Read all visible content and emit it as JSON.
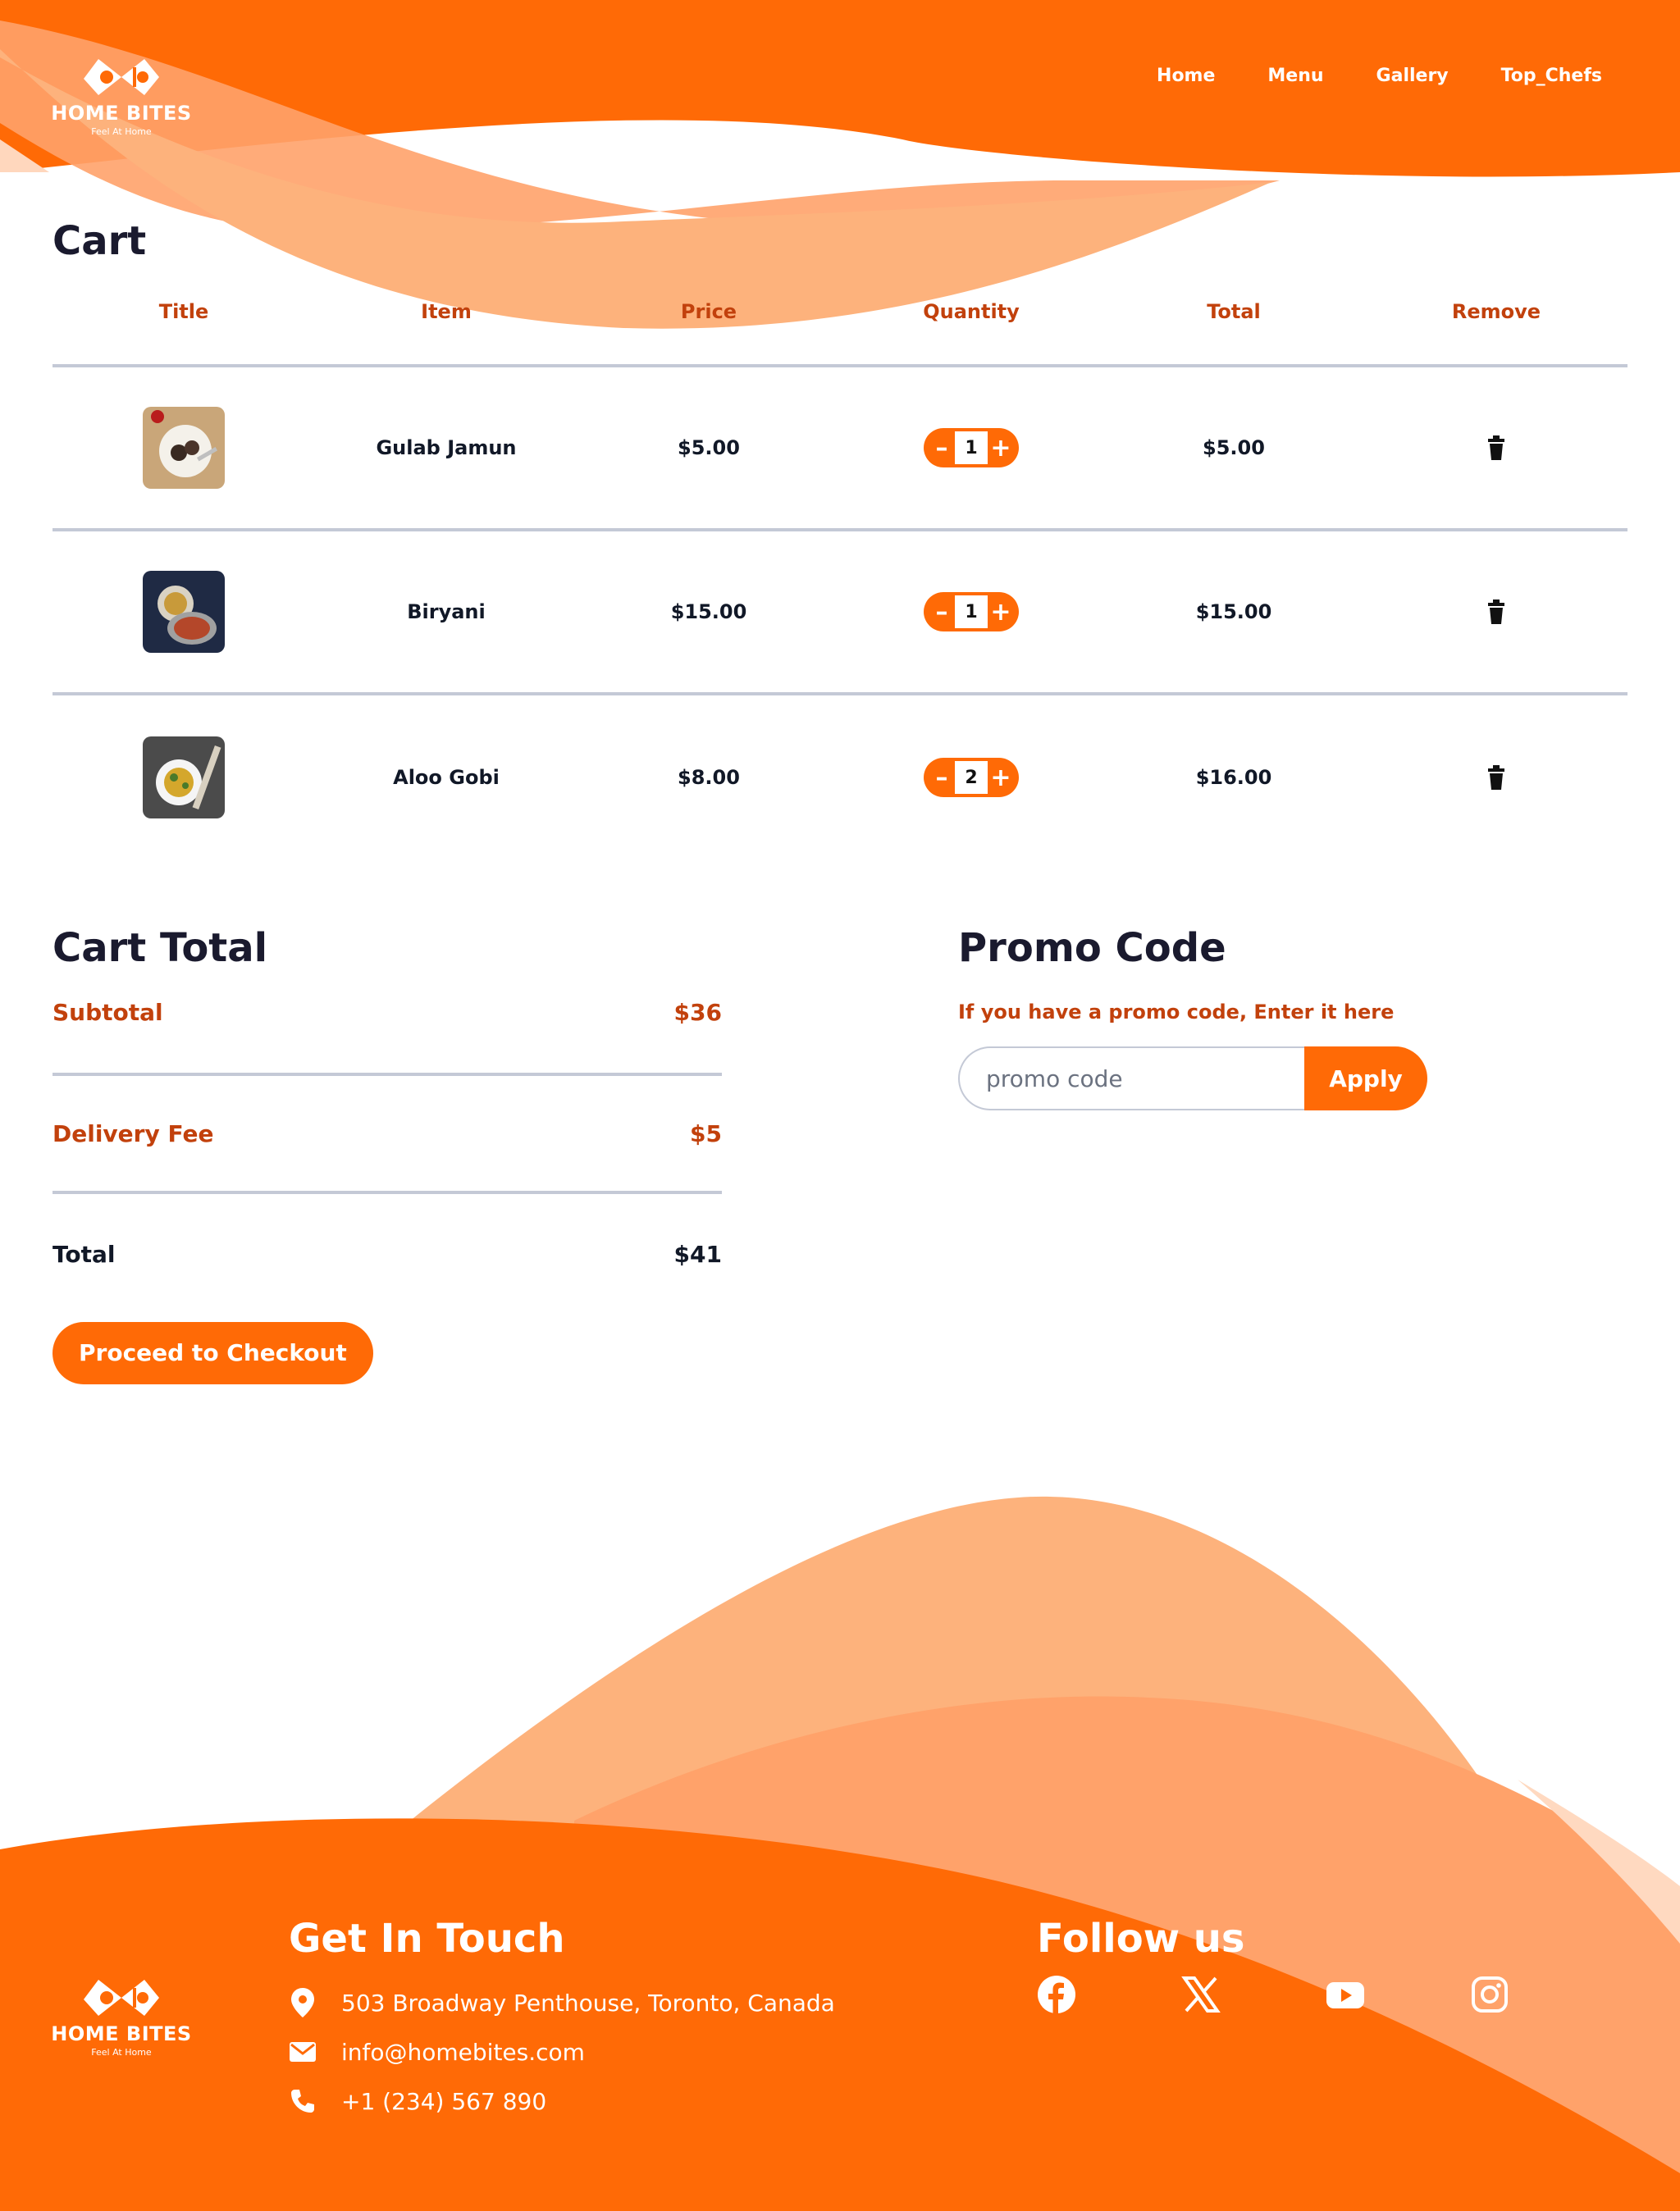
{
  "brand": {
    "name": "HOME BITES",
    "tagline": "Feel At Home"
  },
  "nav": [
    "Home",
    "Menu",
    "Gallery",
    "Top_Chefs"
  ],
  "cart": {
    "title": "Cart",
    "columns": [
      "Title",
      "Item",
      "Price",
      "Quantity",
      "Total",
      "Remove"
    ],
    "items": [
      {
        "name": "Gulab Jamun",
        "price": "$5.00",
        "quantity": "1",
        "total": "$5.00",
        "image": "gulab-jamun-photo"
      },
      {
        "name": "Biryani",
        "price": "$15.00",
        "quantity": "1",
        "total": "$15.00",
        "image": "biryani-photo"
      },
      {
        "name": "Aloo Gobi",
        "price": "$8.00",
        "quantity": "2",
        "total": "$16.00",
        "image": "aloo-gobi-photo"
      }
    ],
    "minus_glyph": "–",
    "plus_glyph": "+"
  },
  "totals": {
    "title": "Cart Total",
    "subtotal_label": "Subtotal",
    "subtotal": "$36",
    "delivery_label": "Delivery Fee",
    "delivery": "$5",
    "total_label": "Total",
    "total": "$41",
    "checkout_label": "Proceed to Checkout"
  },
  "promo": {
    "title": "Promo Code",
    "hint": "If you have a promo code, Enter it here",
    "placeholder": "promo code",
    "apply_label": "Apply"
  },
  "footer": {
    "contact_title": "Get In Touch",
    "address": "503 Broadway Penthouse, Toronto, Canada",
    "email": "info@homebites.com",
    "phone": "+1 (234) 567 890",
    "follow_title": "Follow us",
    "socials": [
      "facebook-icon",
      "x-icon",
      "youtube-icon",
      "instagram-icon"
    ]
  },
  "colors": {
    "accent": "#ff6a06",
    "accent_light": "#fdb27c",
    "heading": "#1a1a2e",
    "label": "#c2410c"
  }
}
